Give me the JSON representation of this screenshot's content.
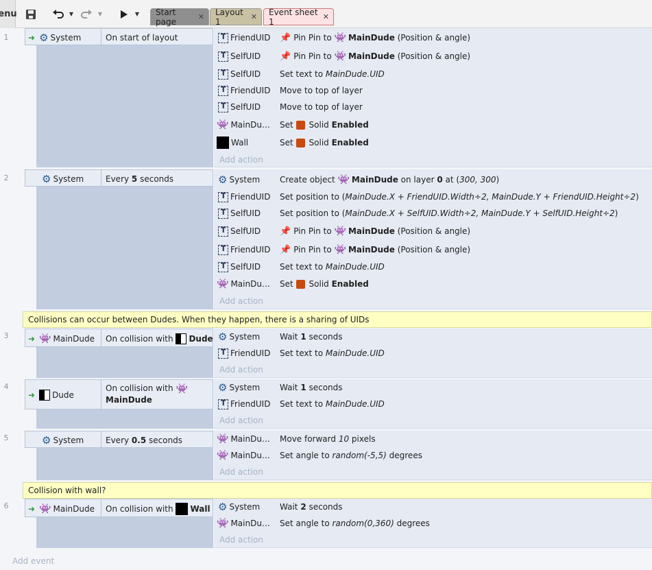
{
  "toolbar": {
    "menu_label": "enu",
    "tabs": [
      {
        "label": "Start page"
      },
      {
        "label": "Layout 1"
      },
      {
        "label": "Event sheet 1"
      }
    ]
  },
  "comments": [
    "Collisions can occur between Dudes.  When they happen, there is a sharing of UIDs",
    "Collision with wall?"
  ],
  "events": [
    {
      "number": "1",
      "trigger": "System",
      "condition": "On start of layout",
      "actions": [
        {
          "object": "FriendUID",
          "text": "Pin Pin to MainDude (Position & angle)"
        },
        {
          "object": "SelfUID",
          "text": "Pin Pin to MainDude (Position & angle)"
        },
        {
          "object": "SelfUID",
          "text": "Set text to MainDude.UID"
        },
        {
          "object": "FriendUID",
          "text": "Move to top of layer"
        },
        {
          "object": "SelfUID",
          "text": "Move to top of layer"
        },
        {
          "object": "MainDu…",
          "text": "Set Solid Enabled"
        },
        {
          "object": "Wall",
          "text": "Set Solid Enabled"
        }
      ]
    },
    {
      "number": "2",
      "trigger": "System",
      "condition": "Every 5 seconds",
      "actions": [
        {
          "object": "System",
          "text": "Create object MainDude on layer 0 at (300, 300)"
        },
        {
          "object": "FriendUID",
          "text": "Set position to (MainDude.X + FriendUID.Width÷2, MainDude.Y + FriendUID.Height÷2)"
        },
        {
          "object": "SelfUID",
          "text": "Set position to (MainDude.X + SelfUID.Width÷2, MainDude.Y + SelfUID.Height÷2)"
        },
        {
          "object": "SelfUID",
          "text": "Pin Pin to MainDude (Position & angle)"
        },
        {
          "object": "FriendUID",
          "text": "Pin Pin to MainDude (Position & angle)"
        },
        {
          "object": "SelfUID",
          "text": "Set text to MainDude.UID"
        },
        {
          "object": "MainDu…",
          "text": "Set Solid Enabled"
        }
      ]
    },
    {
      "number": "3",
      "trigger": "MainDude",
      "condition": "On collision with Dude",
      "actions": [
        {
          "object": "System",
          "text": "Wait 1 seconds"
        },
        {
          "object": "FriendUID",
          "text": "Set text to MainDude.UID"
        }
      ]
    },
    {
      "number": "4",
      "trigger": "Dude",
      "condition": "On collision with MainDude",
      "actions": [
        {
          "object": "System",
          "text": "Wait 1 seconds"
        },
        {
          "object": "FriendUID",
          "text": "Set text to MainDude.UID"
        }
      ]
    },
    {
      "number": "5",
      "trigger": "System",
      "condition": "Every 0.5 seconds",
      "actions": [
        {
          "object": "MainDu…",
          "text": "Move forward 10 pixels"
        },
        {
          "object": "MainDu…",
          "text": "Set angle to random(-5,5) degrees"
        }
      ]
    },
    {
      "number": "6",
      "trigger": "MainDude",
      "condition": "On collision with Wall",
      "actions": [
        {
          "object": "System",
          "text": "Wait 2 seconds"
        },
        {
          "object": "MainDu…",
          "text": "Set angle to random(0,360) degrees"
        }
      ]
    }
  ],
  "add_action_label": "Add action",
  "add_event_label": "Add event",
  "colors": {
    "comment_bg": "#ffffc4",
    "solid_icon": "#c84a10",
    "trigger_arrow": "#2d9a3a",
    "condition_block": "#c3cde0"
  }
}
